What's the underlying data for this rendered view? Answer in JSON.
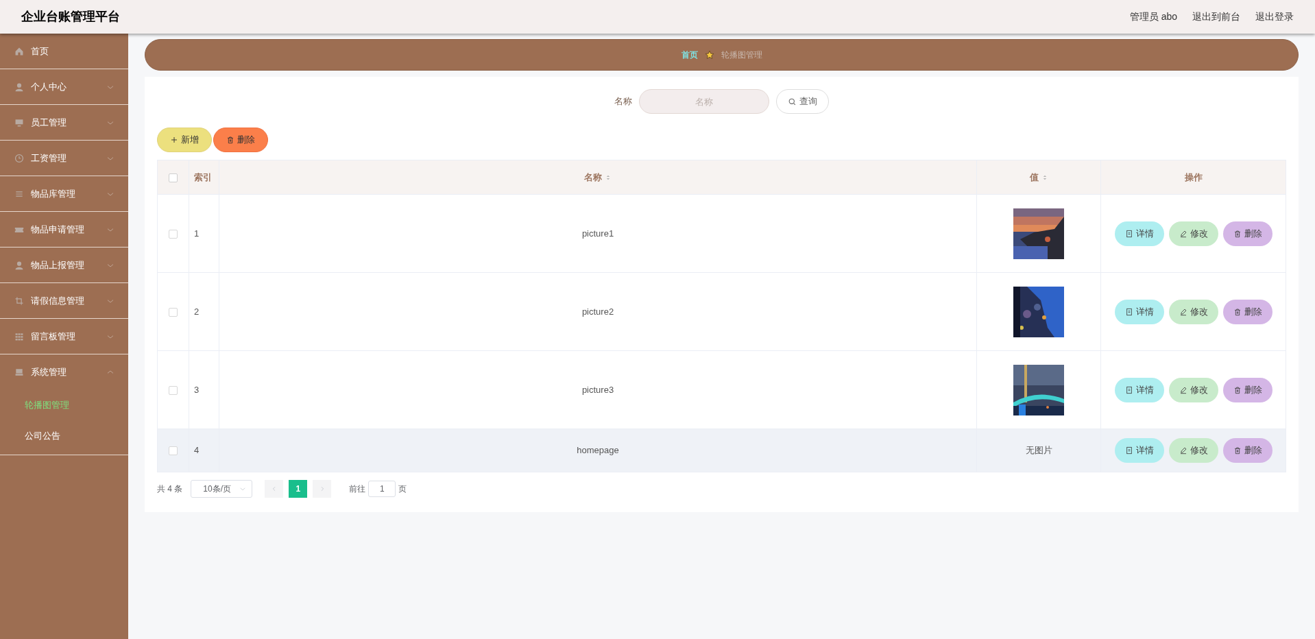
{
  "header": {
    "title": "企业台账管理平台",
    "links": [
      "管理员 abo",
      "退出到前台",
      "退出登录"
    ]
  },
  "sidebar": {
    "items": [
      {
        "label": "首页"
      },
      {
        "label": "个人中心",
        "expanded": false
      },
      {
        "label": "员工管理",
        "expanded": false
      },
      {
        "label": "工资管理",
        "expanded": false
      },
      {
        "label": "物品库管理",
        "expanded": false
      },
      {
        "label": "物品申请管理",
        "expanded": false
      },
      {
        "label": "物品上报管理",
        "expanded": false
      },
      {
        "label": "请假信息管理",
        "expanded": false
      },
      {
        "label": "留言板管理",
        "expanded": false
      },
      {
        "label": "系统管理",
        "expanded": true,
        "children": [
          {
            "label": "轮播图管理",
            "selected": true
          },
          {
            "label": "公司公告",
            "selected": false
          }
        ]
      }
    ]
  },
  "breadcrumb": [
    "首页",
    "轮播图管理"
  ],
  "search": {
    "label": "名称",
    "placeholder": "名称",
    "button": "查询"
  },
  "actions": [
    "新增",
    "删除"
  ],
  "table": {
    "all_checked": false,
    "columns": [
      "索引",
      "名称",
      "值",
      "操作"
    ],
    "rows": [
      {
        "checked": false,
        "index": "1",
        "name": "picture1",
        "value": {
          "kind": "picture"
        },
        "hovered": false,
        "buttons": [
          "详情",
          "修改",
          "删除"
        ]
      },
      {
        "checked": false,
        "index": "2",
        "name": "picture2",
        "value": {
          "kind": "picture"
        },
        "hovered": false,
        "buttons": [
          "详情",
          "修改",
          "删除"
        ]
      },
      {
        "checked": false,
        "index": "3",
        "name": "picture3",
        "value": {
          "kind": "picture"
        },
        "hovered": false,
        "buttons": [
          "详情",
          "修改",
          "删除"
        ]
      },
      {
        "checked": false,
        "index": "4",
        "name": "homepage",
        "value": {
          "kind": "text",
          "text": "无图片"
        },
        "hovered": true,
        "buttons": [
          "详情",
          "修改",
          "删除"
        ]
      }
    ]
  },
  "pagination": {
    "total": "共 4 条",
    "page_size": "10条/页",
    "pages": [
      {
        "label": "1",
        "selected": true
      }
    ],
    "goto_label": "前往",
    "goto_value": "1",
    "goto_suffix": "页"
  }
}
